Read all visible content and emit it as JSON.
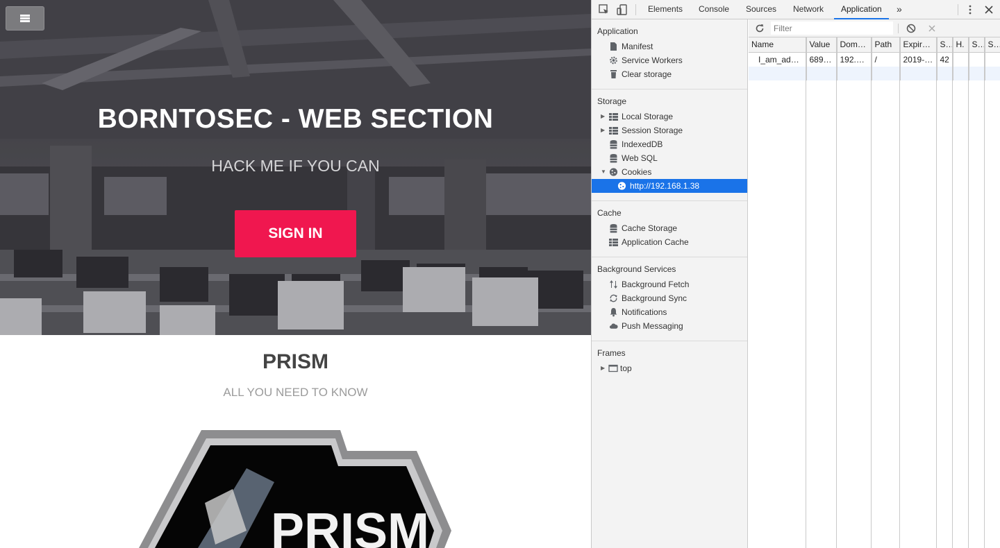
{
  "site": {
    "hero_title": "BORNTOSEC - WEB SECTION",
    "hero_subtitle": "HACK ME IF YOU CAN",
    "signin_label": "SIGN IN",
    "prism_title": "PRISM",
    "prism_subtitle": "ALL YOU NEED TO KNOW",
    "logo_text": "PRISM",
    "accent": "#f0174f"
  },
  "devtools": {
    "tabs": [
      "Elements",
      "Console",
      "Sources",
      "Network",
      "Application"
    ],
    "active_tab": "Application",
    "more_tabs": "»",
    "sidebar": {
      "application": {
        "heading": "Application",
        "items": [
          "Manifest",
          "Service Workers",
          "Clear storage"
        ]
      },
      "storage": {
        "heading": "Storage",
        "items": [
          "Local Storage",
          "Session Storage",
          "IndexedDB",
          "Web SQL",
          "Cookies"
        ],
        "cookie_origin": "http://192.168.1.38"
      },
      "cache": {
        "heading": "Cache",
        "items": [
          "Cache Storage",
          "Application Cache"
        ]
      },
      "background": {
        "heading": "Background Services",
        "items": [
          "Background Fetch",
          "Background Sync",
          "Notifications",
          "Push Messaging"
        ]
      },
      "frames": {
        "heading": "Frames",
        "items": [
          "top"
        ]
      }
    },
    "filter_placeholder": "Filter",
    "table": {
      "headers": [
        "Name",
        "Value",
        "Dom…",
        "Path",
        "Expir…",
        "S…",
        "H.",
        "S…",
        "S…"
      ],
      "rows": [
        [
          "I_am_ad…",
          "689…",
          "192.…",
          "/",
          "2019-…",
          "42",
          "",
          "",
          ""
        ]
      ]
    },
    "selection_color": "#1a73e8"
  }
}
